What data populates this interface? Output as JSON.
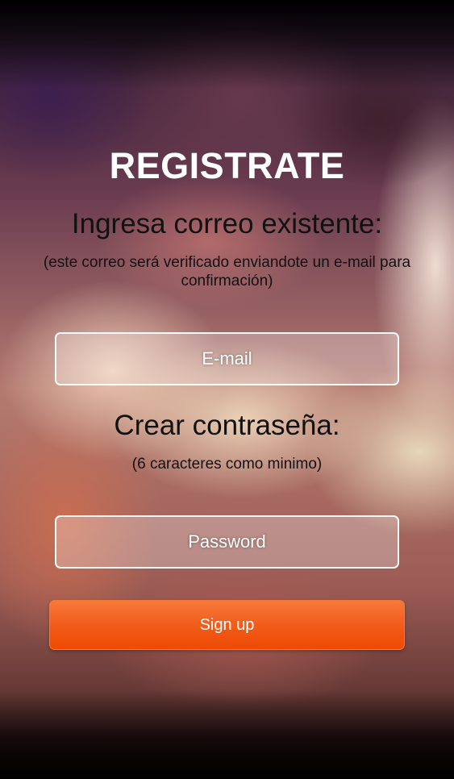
{
  "form": {
    "title": "REGISTRATE",
    "email_heading": "Ingresa correo existente:",
    "email_note": "(este correo será verificado enviandote un e-mail para confirmación)",
    "email_placeholder": "E-mail",
    "email_value": "",
    "password_heading": "Crear contraseña:",
    "password_note": "(6 caracteres como minimo)",
    "password_placeholder": "Password",
    "password_value": "",
    "signup_label": "Sign up"
  },
  "colors": {
    "button_accent": "#f25c1b",
    "title_color": "#ffffff",
    "heading_color": "#111111"
  }
}
